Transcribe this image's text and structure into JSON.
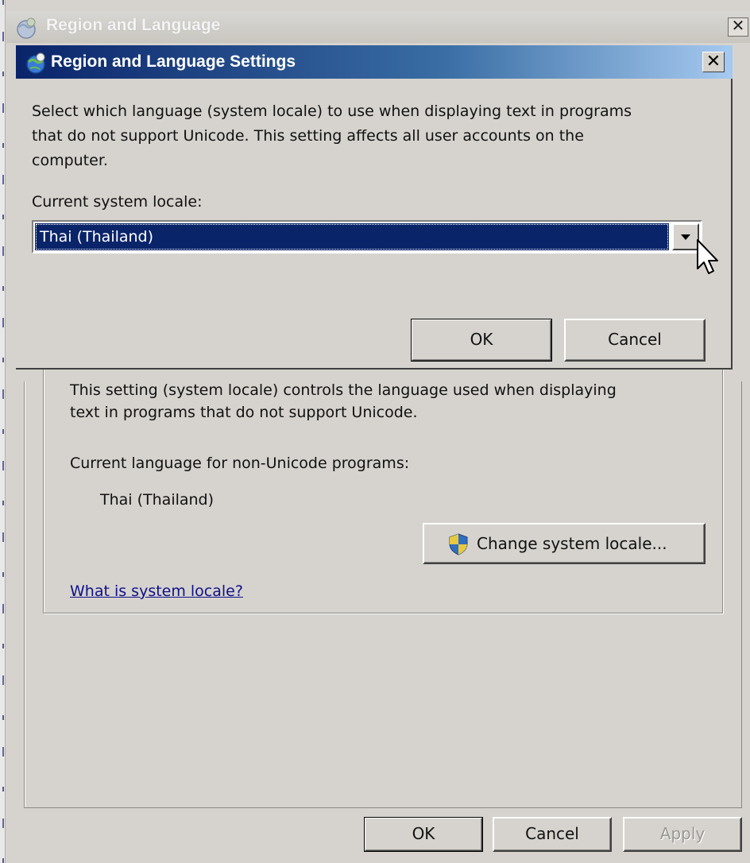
{
  "parent_window": {
    "title": "Region and Language",
    "close_glyph": "✕",
    "group": {
      "description_line1": "This setting (system locale) controls the language used when displaying",
      "description_line2": "text in programs that do not support Unicode.",
      "current_language_label": "Current language for non-Unicode programs:",
      "current_language_value": "Thai (Thailand)",
      "change_button_label": "Change system locale...",
      "help_link": "What is system locale?"
    },
    "buttons": {
      "ok": "OK",
      "cancel": "Cancel",
      "apply": "Apply"
    }
  },
  "dialog": {
    "title": "Region and Language Settings",
    "close_glyph": "✕",
    "description_line1": "Select which language (system locale) to use when displaying text in programs",
    "description_line2": "that do not support Unicode. This setting affects all user accounts on the",
    "description_line3": "computer.",
    "locale_label": "Current system locale:",
    "locale_selected": "Thai (Thailand)",
    "buttons": {
      "ok": "OK",
      "cancel": "Cancel"
    }
  },
  "colors": {
    "dialog_title_start": "#0a246a",
    "dialog_title_end": "#a6caf0",
    "selection": "#0a246a",
    "link": "#10108a",
    "face": "#d6d3ce"
  }
}
